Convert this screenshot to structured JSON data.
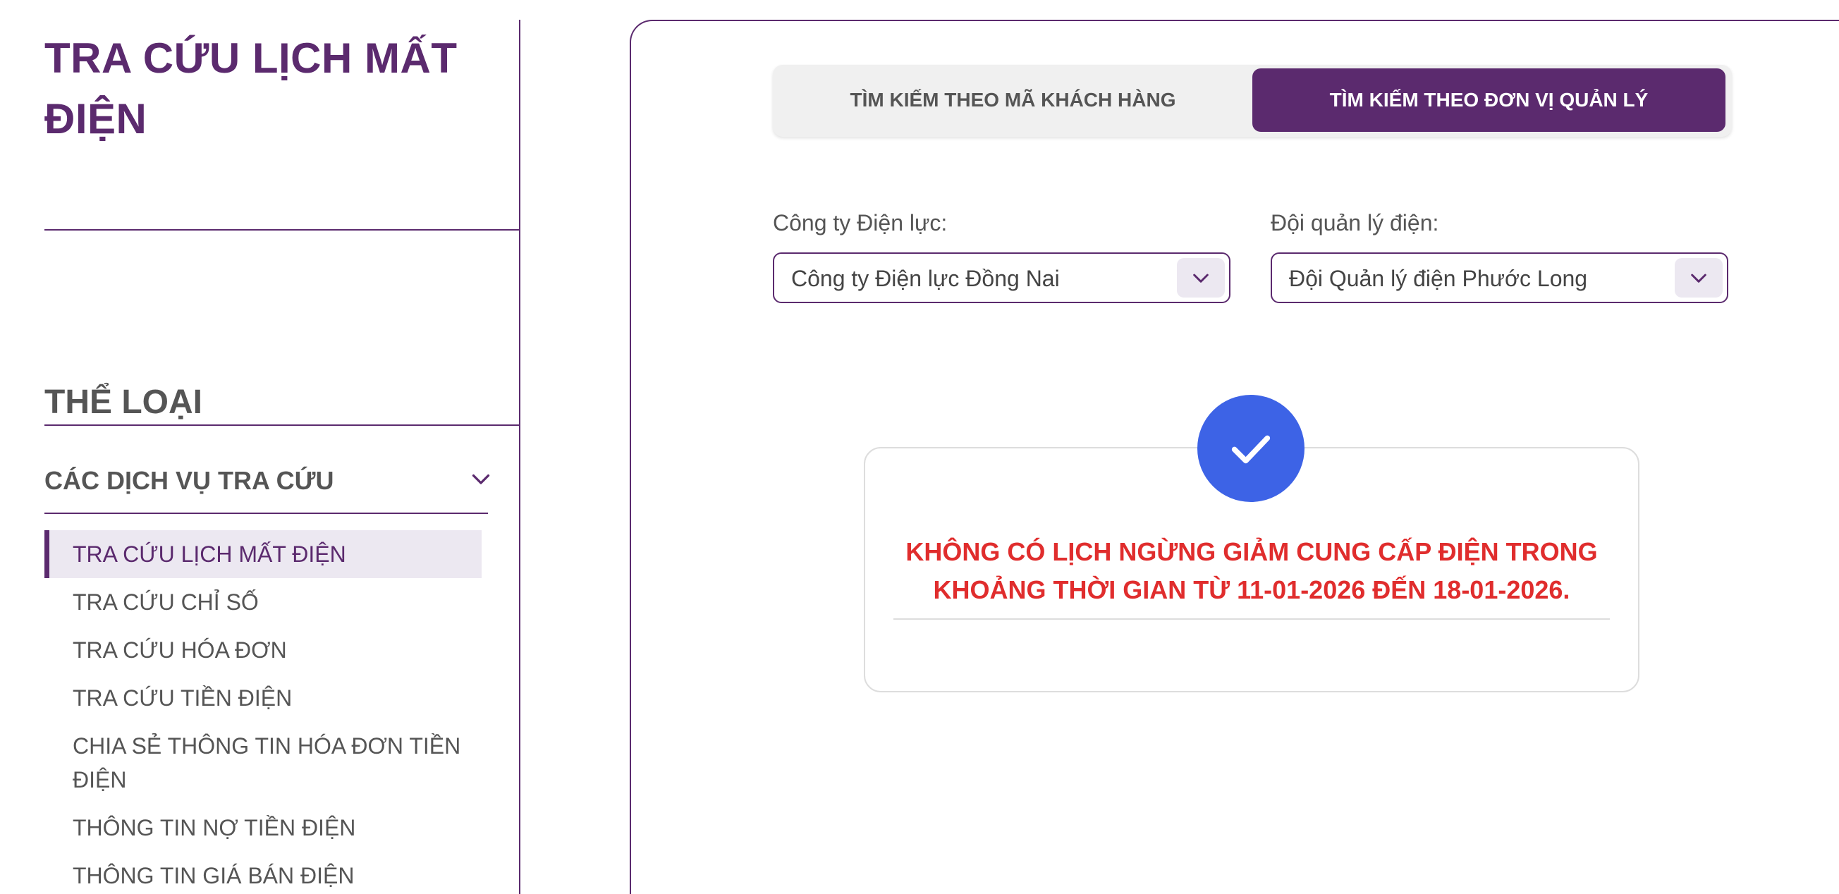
{
  "sidebar": {
    "title": "TRA CỨU LỊCH MẤT ĐIỆN",
    "category_heading": "THỂ LOẠI",
    "group": {
      "label": "CÁC DỊCH VỤ TRA CỨU",
      "expanded": true
    },
    "items": [
      {
        "label": "TRA CỨU LỊCH MẤT ĐIỆN",
        "active": true
      },
      {
        "label": "TRA CỨU CHỈ SỐ",
        "active": false
      },
      {
        "label": "TRA CỨU HÓA ĐƠN",
        "active": false
      },
      {
        "label": "TRA CỨU TIỀN ĐIỆN",
        "active": false
      },
      {
        "label": "CHIA SẺ THÔNG TIN HÓA ĐƠN TIỀN ĐIỆN",
        "active": false
      },
      {
        "label": "THÔNG TIN NỢ TIỀN ĐIỆN",
        "active": false
      },
      {
        "label": "THÔNG TIN GIÁ BÁN ĐIỆN",
        "active": false
      }
    ]
  },
  "tabs": [
    {
      "label": "TÌM KIẾM THEO MÃ KHÁCH HÀNG",
      "active": false
    },
    {
      "label": "TÌM KIẾM THEO ĐƠN VỊ QUẢN LÝ",
      "active": true
    }
  ],
  "filters": {
    "company": {
      "label": "Công ty Điện lực:",
      "value": "Công ty Điện lực Đồng Nai"
    },
    "team": {
      "label": "Đội quản lý điện:",
      "value": "Đội Quản lý điện Phước Long"
    }
  },
  "result": {
    "icon": "check-icon",
    "message": "KHÔNG CÓ LỊCH NGỪNG GIẢM CUNG CẤP ĐIỆN TRONG KHOẢNG THỜI GIAN TỪ 11-01-2026 ĐẾN 18-01-2026."
  },
  "colors": {
    "brand_purple": "#5b2a6e",
    "active_item_bg": "#ece8f1",
    "success_blue": "#3d63e6",
    "error_red": "#e02d2d",
    "text_gray": "#555555"
  }
}
